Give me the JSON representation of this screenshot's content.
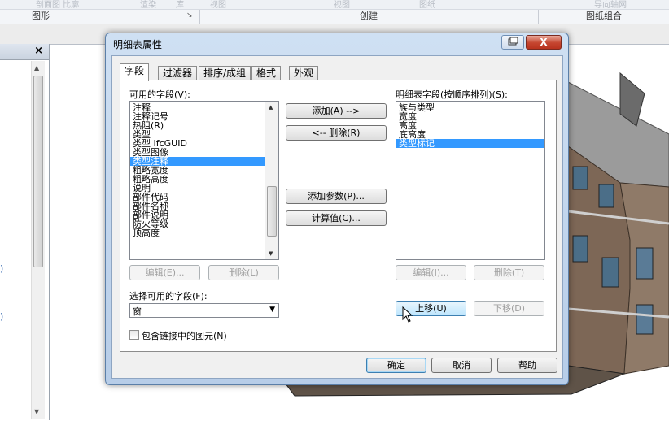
{
  "ribbon": {
    "faint_top_items": [
      "剖面图 比廓",
      "渲染",
      "库",
      "视图",
      "视图",
      "图纸",
      "导向轴网"
    ],
    "groups": [
      "图形",
      "创建",
      "图纸组合"
    ],
    "group_corner_glyph": "↘"
  },
  "side_panel": {
    "close_glyph": "×",
    "edge_glyphs": [
      ")",
      ")"
    ]
  },
  "dialog": {
    "title": "明细表属性",
    "close_glyph": "X",
    "tabs": [
      "字段",
      "过滤器",
      "排序/成组",
      "格式",
      "外观"
    ],
    "active_tab": "字段",
    "available_label": "可用的字段(V):",
    "available_fields": [
      "注释",
      "注释记号",
      "热阻(R)",
      "类型",
      "类型 IfcGUID",
      "类型图像",
      "类型注释",
      "粗略宽度",
      "粗略高度",
      "说明",
      "部件代码",
      "部件名称",
      "部件说明",
      "防火等级",
      "顶高度"
    ],
    "available_selected": "类型注释",
    "scheduled_label": "明细表字段(按顺序排列)(S):",
    "scheduled_fields": [
      "族与类型",
      "宽度",
      "高度",
      "底高度",
      "类型标记"
    ],
    "scheduled_selected": "类型标记",
    "add_button": "添加(A) -->",
    "remove_button": "<-- 删除(R)",
    "add_param_button": "添加参数(P)...",
    "calc_button": "计算值(C)...",
    "edit_left": "编辑(E)...",
    "delete_left": "删除(L)",
    "edit_right": "编辑(I)...",
    "delete_right": "删除(T)",
    "select_from_label": "选择可用的字段(F):",
    "select_from_value": "窗",
    "move_up": "上移(U)",
    "move_down": "下移(D)",
    "include_linked": "包含链接中的图元(N)",
    "ok": "确定",
    "cancel": "取消",
    "help": "帮助"
  }
}
